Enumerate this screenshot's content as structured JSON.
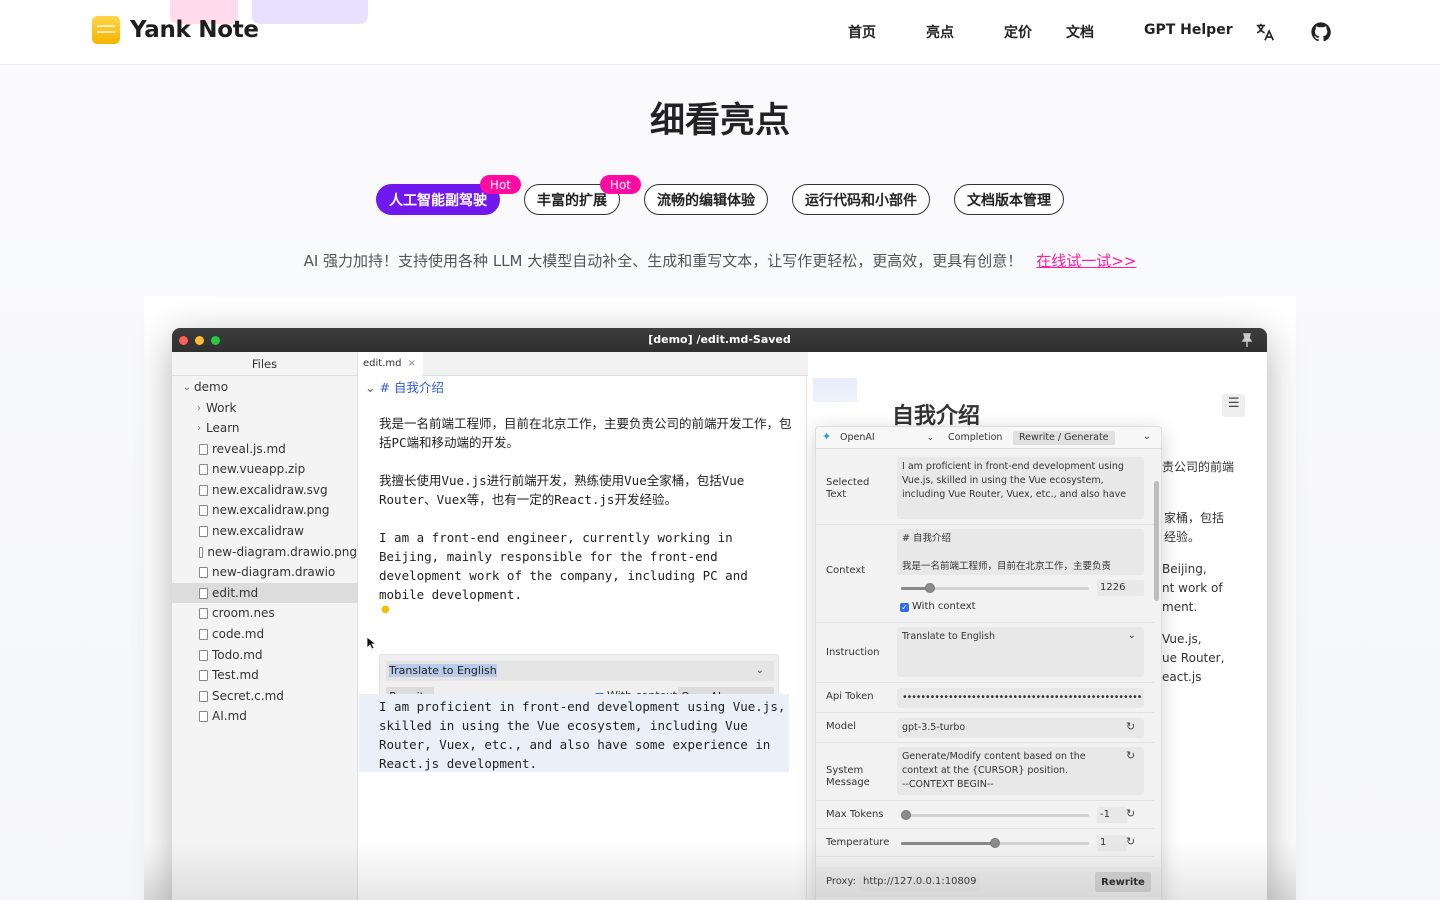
{
  "brand": {
    "name": "Yank Note"
  },
  "nav": {
    "home": "首页",
    "highlights": "亮点",
    "pricing": "定价",
    "docs": "文档",
    "gpt": "GPT Helper"
  },
  "section": {
    "title": "细看亮点",
    "tabs": [
      {
        "label": "人工智能副驾驶",
        "badge": "Hot",
        "active": true
      },
      {
        "label": "丰富的扩展",
        "badge": "Hot",
        "active": false
      },
      {
        "label": "流畅的编辑体验",
        "badge": "",
        "active": false
      },
      {
        "label": "运行代码和小部件",
        "badge": "",
        "active": false
      },
      {
        "label": "文档版本管理",
        "badge": "",
        "active": false
      }
    ],
    "description": "AI 强力加持！支持使用各种 LLM 大模型自动补全、生成和重写文本，让写作更轻松，更高效，更具有创意！",
    "try_link": "在线试一试>>"
  },
  "app": {
    "window_title": "[demo] /edit.md-Saved",
    "sidebar": {
      "header": "Files",
      "items": [
        {
          "label": "demo",
          "type": "folder-open"
        },
        {
          "label": "Work",
          "type": "folder"
        },
        {
          "label": "Learn",
          "type": "folder"
        },
        {
          "label": "reveal.js.md",
          "type": "file"
        },
        {
          "label": "new.vueapp.zip",
          "type": "file"
        },
        {
          "label": "new.excalidraw.svg",
          "type": "file"
        },
        {
          "label": "new.excalidraw.png",
          "type": "file"
        },
        {
          "label": "new.excalidraw",
          "type": "file"
        },
        {
          "label": "new-diagram.drawio.png",
          "type": "file"
        },
        {
          "label": "new-diagram.drawio",
          "type": "file"
        },
        {
          "label": "edit.md",
          "type": "file",
          "selected": true
        },
        {
          "label": "croom.nes",
          "type": "file"
        },
        {
          "label": "code.md",
          "type": "file"
        },
        {
          "label": "Todo.md",
          "type": "file"
        },
        {
          "label": "Test.md",
          "type": "file"
        },
        {
          "label": "Secret.c.md",
          "type": "file"
        },
        {
          "label": "AI.md",
          "type": "file"
        }
      ]
    },
    "editor": {
      "tab": "edit.md",
      "tab_close": "×",
      "heading": "# 自我介绍",
      "para1": "我是一名前端工程师，目前在北京工作，主要负责公司的前端开发工作，包括PC端和移动端的开发。",
      "para2": "我擅长使用Vue.js进行前端开发，熟练使用Vue全家桶，包括Vue Router、Vuex等，也有一定的React.js开发经验。",
      "para3": "I am a front-end engineer, currently working in Beijing, mainly responsible for the front-end development work of the company, including PC and mobile development.",
      "tool_instruction": "Translate to English",
      "rewrite_button": "Rewrite",
      "with_context": "With context",
      "provider": "OpenAI",
      "result": "I am proficient in front-end development using Vue.js, skilled in using the Vue ecosystem, including Vue Router, Vuex, etc., and also have some experience in React.js development."
    },
    "preview": {
      "title": "自我介绍",
      "fragments": [
        "责公司的前端",
        "家桶，包括",
        "经验。",
        "Beijing,",
        "nt work of",
        "ment.",
        "Vue.js,",
        "ue Router,",
        "eact.js"
      ]
    },
    "ai_panel": {
      "provider": "OpenAI",
      "tab_completion": "Completion",
      "tab_rewrite": "Rewrite / Generate",
      "selected_text_label": "Selected Text",
      "selected_text": "I am proficient in front-end development using Vue.js, skilled in using the Vue ecosystem, including Vue Router, Vuex, etc., and also have",
      "context_label": "Context",
      "context_text": "# 自我介绍\n\n我是一名前端工程师，目前在北京工作，主要负责",
      "context_length": "1226",
      "with_context": "With context",
      "instruction_label": "Instruction",
      "instruction": "Translate to English",
      "api_token_label": "Api Token",
      "api_token": "••••••••••••••••••••••••••••••••••••••••••••••••••••",
      "model_label": "Model",
      "model": "gpt-3.5-turbo",
      "system_message_label": "System Message",
      "system_message": "Generate/Modify content based on the context at the {CURSOR} position.\n--CONTEXT BEGIN--",
      "max_tokens_label": "Max Tokens",
      "max_tokens": "-1",
      "temperature_label": "Temperature",
      "temperature": "1",
      "proxy_label": "Proxy:",
      "proxy": "http://127.0.0.1:10809",
      "rewrite_button": "Rewrite"
    }
  },
  "colors": {
    "accent": "#7018ee",
    "hot": "#ff0aa3",
    "link": "#ff1aa8"
  }
}
